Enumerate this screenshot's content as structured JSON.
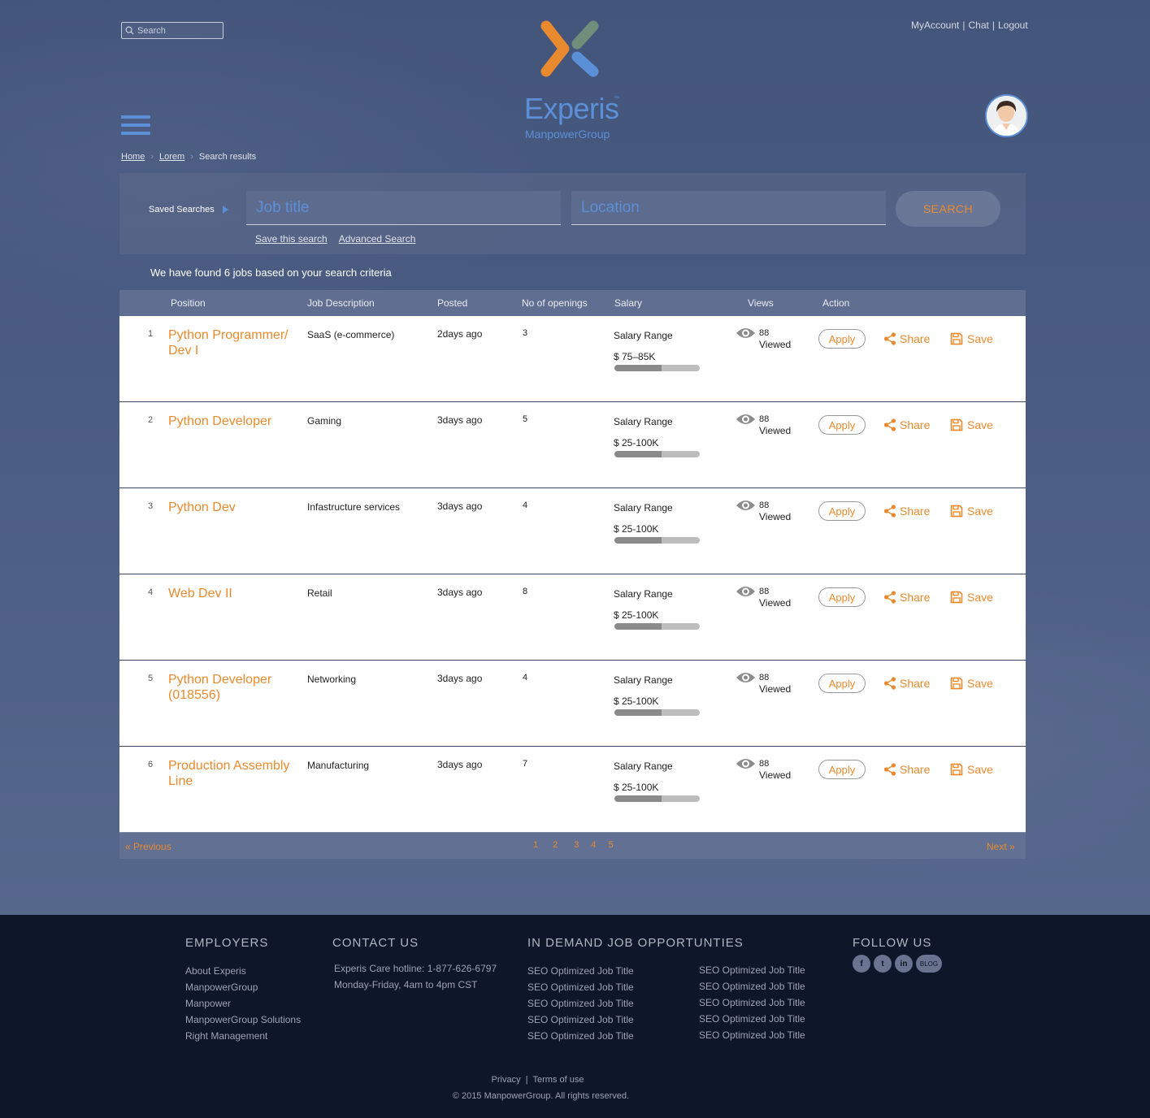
{
  "header": {
    "search_placeholder": "Search",
    "account_links": [
      "MyAccount",
      "Chat",
      "Logout"
    ],
    "separator": "|",
    "brand_name": "Experis",
    "brand_tm": "™",
    "brand_sub": "ManpowerGroup"
  },
  "breadcrumb": [
    "Home",
    "Lorem",
    "Search results"
  ],
  "search": {
    "saved_searches": "Saved Searches",
    "job_title_placeholder": "Job title",
    "location_placeholder": "Location",
    "search_label": "SEARCH",
    "save_search": "Save this search",
    "advanced_search": "Advanced Search"
  },
  "results_summary": "We have found 6 jobs based on your search criteria",
  "table": {
    "columns": [
      "Position",
      "Job Description",
      "Posted",
      "No of openings",
      "Salary",
      "Views",
      "Action"
    ],
    "salary_label": "Salary Range",
    "views_label": "Viewed",
    "apply_label": "Apply",
    "share_label": "Share",
    "save_label": "Save",
    "rows": [
      {
        "num": "1",
        "position": "Python Programmer/ Dev I",
        "description": "SaaS (e-commerce)",
        "posted": "2days ago",
        "openings": "3",
        "salary": "$ 75–85K",
        "salary_fill": 0.55,
        "views": "88"
      },
      {
        "num": "2",
        "position": "Python Developer",
        "description": "Gaming",
        "posted": "3days ago",
        "openings": "5",
        "salary": "$ 25-100K",
        "salary_fill": 0.55,
        "views": "88"
      },
      {
        "num": "3",
        "position": "Python Dev",
        "description": "Infastructure services",
        "posted": "3days ago",
        "openings": "4",
        "salary": "$ 25-100K",
        "salary_fill": 0.55,
        "views": "88"
      },
      {
        "num": "4",
        "position": "Web Dev II",
        "description": "Retail",
        "posted": "3days ago",
        "openings": "8",
        "salary": "$ 25-100K",
        "salary_fill": 0.55,
        "views": "88"
      },
      {
        "num": "5",
        "position": "Python Developer (018556)",
        "description": "Networking",
        "posted": "3days ago",
        "openings": "4",
        "salary": "$ 25-100K",
        "salary_fill": 0.55,
        "views": "88"
      },
      {
        "num": "6",
        "position": "Production Assembly Line",
        "description": "Manufacturing",
        "posted": "3days ago",
        "openings": "7",
        "salary": "$ 25-100K",
        "salary_fill": 0.55,
        "views": "88"
      }
    ]
  },
  "pagination": {
    "previous": "Previous",
    "next": "Next",
    "pages": [
      "1",
      "2",
      "3",
      "4",
      "5"
    ]
  },
  "footer": {
    "employers_title": "EMPLOYERS",
    "employers": [
      "About Experis",
      "ManpowerGroup",
      "Manpower",
      "ManpowerGroup Solutions",
      "Right Management"
    ],
    "contact_title": "CONTACT US",
    "contact_hotline": "Experis Care hotline: 1-877-626-6797",
    "contact_hours": "Monday-Friday, 4am to 4pm CST",
    "jobs_title": "IN DEMAND JOB OPPORTUNTIES",
    "jobs_col1": [
      "SEO Optimized Job Title",
      "SEO Optimized Job Title",
      "SEO Optimized Job Title",
      "SEO Optimized Job Title",
      "SEO Optimized Job Title"
    ],
    "jobs_col2": [
      "SEO Optimized Job Title",
      "SEO Optimized Job Title",
      "SEO Optimized Job Title",
      "SEO Optimized Job Title",
      "SEO Optimized Job Title"
    ],
    "follow_title": "FOLLOW US",
    "social": [
      "f",
      "t",
      "in",
      "BLOG"
    ],
    "privacy": "Privacy",
    "terms": "Terms of use",
    "copyright": "© 2015 ManpowerGroup. All rights reserved."
  },
  "colors": {
    "accent": "#e98a2e",
    "brand_blue": "#5b8fd8",
    "footer_bg": "#0e1629"
  }
}
